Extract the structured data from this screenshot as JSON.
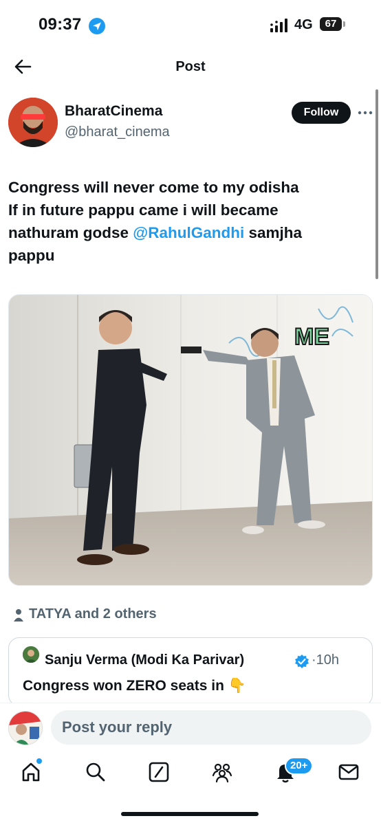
{
  "status_bar": {
    "time": "09:37",
    "network": "4G",
    "battery": "67"
  },
  "header": {
    "title": "Post"
  },
  "post": {
    "author_name": "BharatCinema",
    "author_handle": "@bharat_cinema",
    "follow_label": "Follow",
    "text_line1": "Congress will never come to my odisha",
    "text_line2": "If in future pappu came i will  became",
    "text_line3a": "nathuram godse ",
    "mention": "@RahulGandhi",
    "text_line3b": "  samjha",
    "text_line4": "pappu",
    "image_caption": "ME"
  },
  "reposted_by": "TATYA and 2 others",
  "quote": {
    "author_name": "Sanju Verma (Modi Ka Parivar)",
    "time": "·10h",
    "text": "Congress won ZERO seats in 👇"
  },
  "reply": {
    "placeholder": "Post your reply"
  },
  "nav": {
    "items": [
      "home-icon",
      "search-icon",
      "grok-icon",
      "communities-icon",
      "notifications-icon",
      "messages-icon"
    ],
    "notif_badge": "20+"
  },
  "colors": {
    "accent": "#1d9bf0",
    "text": "#0f1419",
    "secondary": "#536471"
  }
}
